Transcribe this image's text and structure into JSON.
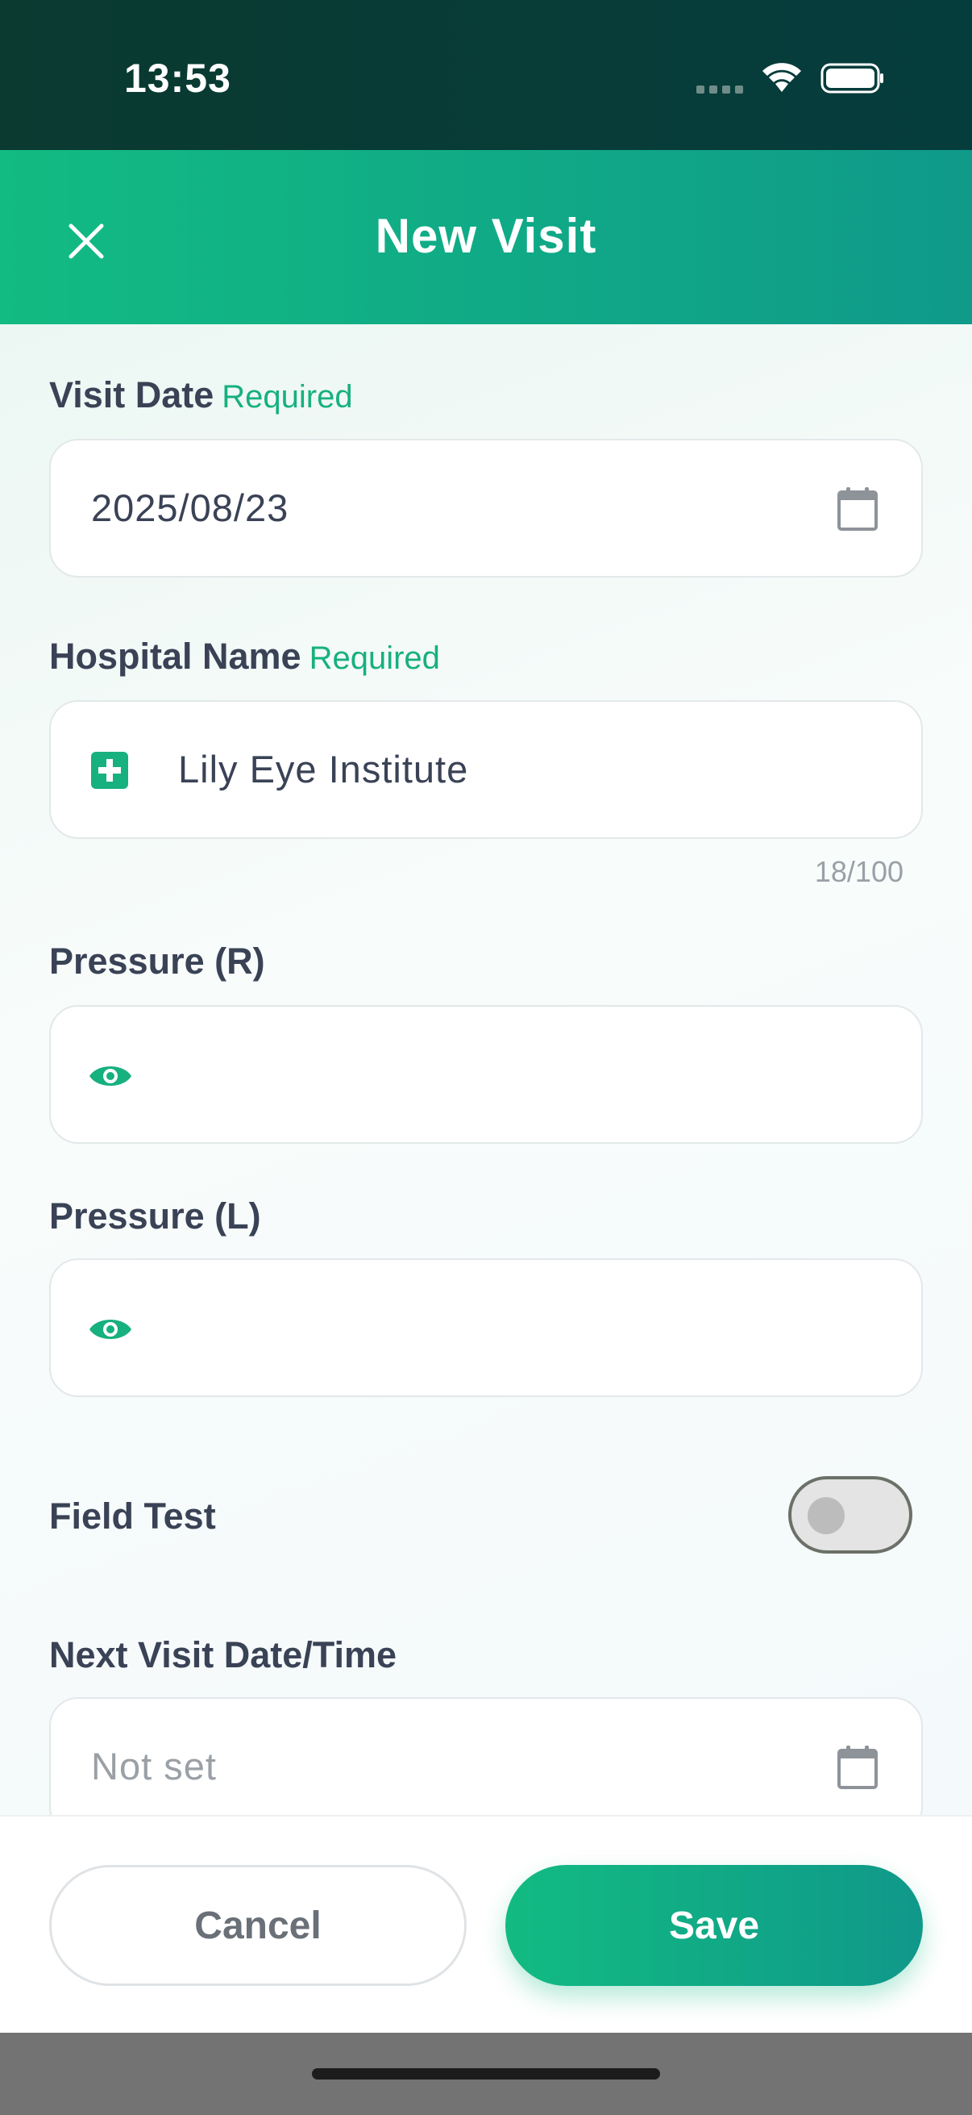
{
  "status_bar": {
    "time": "13:53"
  },
  "header": {
    "title": "New Visit",
    "close_icon": "close-icon"
  },
  "form": {
    "visit_date": {
      "label": "Visit Date",
      "required_tag": "Required",
      "value": "2025/08/23",
      "icon": "calendar-icon"
    },
    "hospital_name": {
      "label": "Hospital Name",
      "required_tag": "Required",
      "value": "Lily Eye Institute",
      "icon": "medical-cross-icon",
      "counter": "18/100"
    },
    "pressure_right": {
      "label": "Pressure (R)",
      "value": "",
      "icon": "eye-icon"
    },
    "pressure_left": {
      "label": "Pressure (L)",
      "value": "",
      "icon": "eye-icon"
    },
    "field_test": {
      "label": "Field Test",
      "enabled": false
    },
    "next_visit": {
      "label": "Next Visit Date/Time",
      "placeholder": "Not set",
      "icon": "calendar-icon"
    }
  },
  "actions": {
    "cancel_label": "Cancel",
    "save_label": "Save"
  },
  "colors": {
    "accent": "#12bb82",
    "accent_dark": "#0f9a8a",
    "status_bar": "#0a3a30",
    "label": "#3a4256"
  }
}
